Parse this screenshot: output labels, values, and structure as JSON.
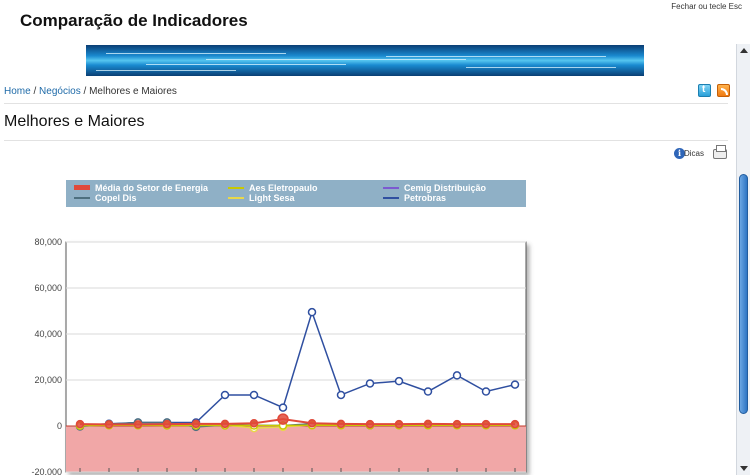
{
  "window": {
    "title": "Comparação de Indicadores",
    "close_hint": "Fechar ou tecle Esc"
  },
  "breadcrumb": {
    "home": "Home",
    "sep1": "/",
    "business": "Negócios",
    "sep2": "/",
    "current": "Melhores e Maiores"
  },
  "page": {
    "heading": "Melhores e Maiores",
    "tips_label": "Dicas"
  },
  "colors": {
    "twitter": "#2aa0d8",
    "rss": "#f07a12",
    "negative_zone": "#f1a7a7",
    "legend_bg": "#8fb0c6"
  },
  "icons": [
    "twitter-icon",
    "rss-icon",
    "info-icon",
    "print-icon"
  ],
  "chart_data": {
    "type": "line",
    "ylim": [
      -20000,
      80000
    ],
    "yticks": [
      {
        "value": 80000,
        "label": "80,000"
      },
      {
        "value": 60000,
        "label": "60,000"
      },
      {
        "value": 40000,
        "label": "40,000"
      },
      {
        "value": 20000,
        "label": "20,000"
      },
      {
        "value": 0,
        "label": "0"
      },
      {
        "value": -20000,
        "label": "-20,000"
      }
    ],
    "num_points": 16,
    "legend": [
      {
        "name": "Média do Setor de Energia",
        "color": "#e0493a",
        "marker": "bar"
      },
      {
        "name": "Aes Eletropaulo",
        "color": "#c8c800",
        "marker": "line"
      },
      {
        "name": "Cemig Distribuição",
        "color": "#7b5ad0",
        "marker": "line"
      },
      {
        "name": "Copel Dis",
        "color": "#4d6f7f",
        "marker": "line"
      },
      {
        "name": "Light Sesa",
        "color": "#e8d84a",
        "marker": "line"
      },
      {
        "name": "Petrobras",
        "color": "#2f4fa0",
        "marker": "line"
      }
    ],
    "series": [
      {
        "name": "Petrobras",
        "color": "#2f4fa0",
        "values": [
          200,
          1000,
          1500,
          1500,
          1500,
          13500,
          13500,
          8000,
          49500,
          13500,
          18500,
          19500,
          15000,
          22000,
          15000,
          18000
        ]
      },
      {
        "name": "Copel Dis",
        "color": "#4d6f7f",
        "values": [
          -200,
          800,
          1500,
          1500,
          -400,
          400,
          300,
          200,
          1000,
          500,
          300,
          400,
          500,
          600,
          500,
          500
        ]
      },
      {
        "name": "Light Sesa",
        "color": "#e8d84a",
        "values": [
          300,
          500,
          400,
          400,
          500,
          500,
          -900,
          -400,
          500,
          500,
          500,
          500,
          500,
          500,
          500,
          500
        ]
      },
      {
        "name": "Aes Eletropaulo",
        "color": "#c8c800",
        "values": [
          100,
          300,
          300,
          200,
          200,
          200,
          200,
          200,
          300,
          300,
          300,
          300,
          300,
          300,
          300,
          300
        ]
      },
      {
        "name": "Média do Setor de Energia",
        "color": "#e0493a",
        "values": [
          800,
          700,
          700,
          800,
          900,
          900,
          1200,
          3000,
          1200,
          900,
          800,
          800,
          900,
          800,
          800,
          800
        ]
      }
    ]
  }
}
